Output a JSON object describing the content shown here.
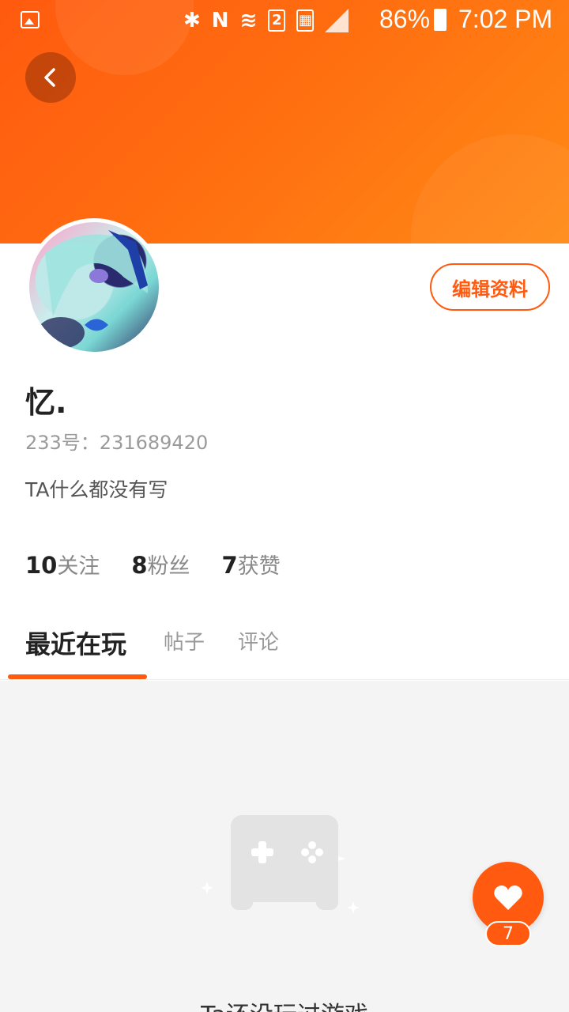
{
  "colors": {
    "accent": "#ff5a0f",
    "header_gradient_start": "#ff5a0f",
    "header_gradient_end": "#ff8a16",
    "content_bg": "#f4f4f4"
  },
  "status_bar": {
    "battery_percent": "86%",
    "time": "7:02 PM",
    "sim_label": "2",
    "icons": [
      "image-icon",
      "bluetooth-icon",
      "nfc-icon",
      "wifi-icon",
      "sim-icon",
      "sd-card-icon",
      "signal-icon",
      "battery-icon"
    ]
  },
  "header": {
    "back_icon": "chevron-left-icon"
  },
  "profile": {
    "edit_label": "编辑资料",
    "name": "忆.",
    "uid": "233号：231689420",
    "bio": "TA什么都没有写",
    "stats": {
      "following_count": "10",
      "following_label": "关注",
      "fans_count": "8",
      "fans_label": "粉丝",
      "likes_count": "7",
      "likes_label": "获赞"
    }
  },
  "tabs": [
    {
      "label": "最近在玩",
      "active": true
    },
    {
      "label": "帖子",
      "active": false
    },
    {
      "label": "评论",
      "active": false
    }
  ],
  "empty_state": {
    "icon": "gamepad-icon",
    "text": "Ta还没玩过游戏"
  },
  "like_button": {
    "icon": "heart-icon",
    "count": "7"
  }
}
